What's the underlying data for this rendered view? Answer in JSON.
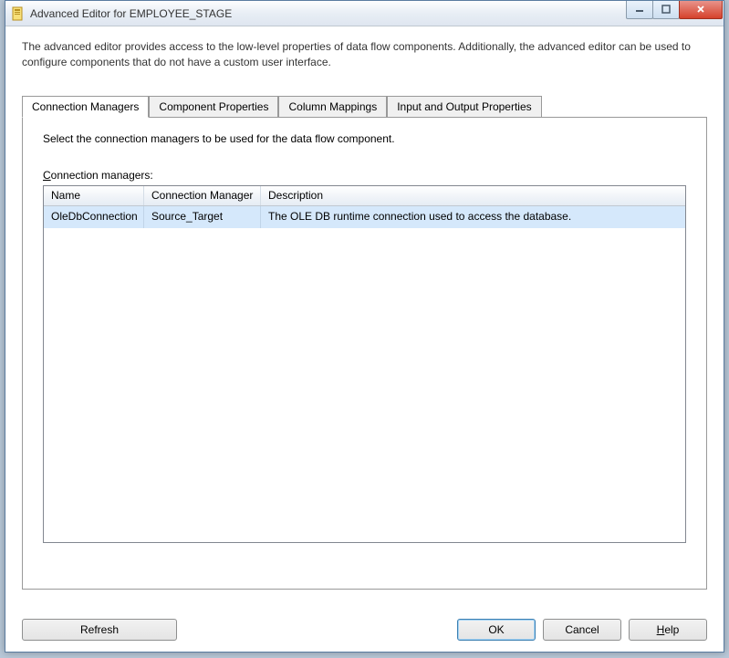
{
  "window": {
    "title": "Advanced Editor for EMPLOYEE_STAGE"
  },
  "description": "The advanced editor provides access to the low-level properties of data flow components. Additionally, the advanced editor can be used to configure components that do not have a custom user interface.",
  "tabs": [
    {
      "label": "Connection Managers"
    },
    {
      "label": "Component Properties"
    },
    {
      "label": "Column Mappings"
    },
    {
      "label": "Input and Output Properties"
    }
  ],
  "panel": {
    "desc": "Select the connection managers to be used for the data flow component.",
    "label_pre": "C",
    "label_rest": "onnection managers:"
  },
  "grid": {
    "headers": {
      "name": "Name",
      "manager": "Connection Manager",
      "desc": "Description"
    },
    "rows": [
      {
        "name": "OleDbConnection",
        "manager": "Source_Target",
        "desc": "The OLE DB runtime connection used to access the database."
      }
    ]
  },
  "buttons": {
    "refresh": "Refresh",
    "ok": "OK",
    "cancel": "Cancel",
    "help_pre": "H",
    "help_rest": "elp"
  }
}
